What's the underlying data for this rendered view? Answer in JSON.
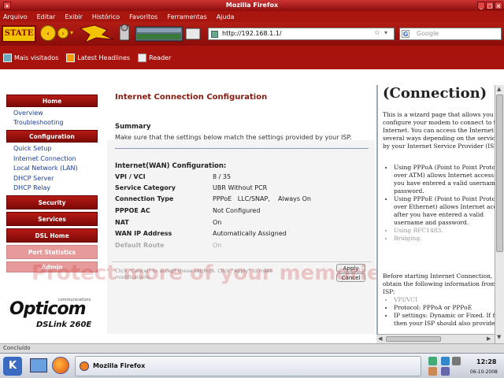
{
  "window": {
    "title": "Mozilla Firefox"
  },
  "menu": [
    "Arquivo",
    "Editar",
    "Exibir",
    "Histórico",
    "Favoritos",
    "Ferramentas",
    "Ajuda"
  ],
  "navbar": {
    "logo_text": "STATE",
    "url": "http://192.168.1.1/",
    "search_placeholder": "Google"
  },
  "bookmarks": [
    "Mais visitados",
    "Latest Headlines",
    "Reader"
  ],
  "sidebar": {
    "home": "Home",
    "home_links": [
      "Overview",
      "Troubleshooting"
    ],
    "configuration": "Configuration",
    "config_links": [
      "Quick Setup",
      "Internet Connection",
      "Local Network (LAN)",
      "DHCP Server",
      "DHCP Relay"
    ],
    "security": "Security",
    "services": "Services",
    "dsl_home": "DSL Home",
    "port_statistics": "Port Statistics",
    "admin": "Admin",
    "logo_small": "communications",
    "logo": "Opticom",
    "model": "DSLink 260E"
  },
  "main": {
    "title": "Internet Connection Configuration",
    "summary_label": "Summary",
    "summary_text": "Make sure that the settings below match the settings provided by your ISP.",
    "section": "Internet(WAN) Configuration:",
    "rows": [
      {
        "label": "VPI / VCI",
        "value": "8 / 35"
      },
      {
        "label": "Service Category",
        "value": "UBR Without PCR"
      },
      {
        "label": "Connection Type",
        "value": "PPPoE   LLC/SNAP,    Always On"
      },
      {
        "label": "PPPOE AC",
        "value": "Not Configured"
      },
      {
        "label": "NAT",
        "value": "On"
      },
      {
        "label": "WAN IP Address",
        "value": "Automatically Assigned"
      },
      {
        "label": "Default Route",
        "value": "On"
      }
    ],
    "footer_note": "Click \"Cancel\" to accept these settings. Click \"Apply\" to make modifications.",
    "apply": "Apply",
    "cancel": "Cancel",
    "watermark": "Protect more of your memories"
  },
  "wizard": {
    "heading": "(Connection)",
    "intro": "This is a wizard page that allows you to configure your modem to connect to the Internet. You can access the Internet in several ways depending on the service offered by your Internet Service Provider (ISP).",
    "bullets": [
      "Using PPPoA (Point to Point Protocol over ATM) allows Internet access after you have entered a valid username and password.",
      "Using PPPoE (Point to Point Protocol over Ethernet) allows Internet access after you have entered a valid username and password.",
      "Using RFC1483.",
      "Bridging."
    ],
    "before": "Before starting Internet Connection, please obtain the following information from your ISP:",
    "info": [
      "VPI/VCI",
      "Protocol: PPPoA or PPPoE",
      "IP settings: Dynamic or Fixed. If fixed, then your ISP should also provide"
    ]
  },
  "status": {
    "text": "Concluído"
  },
  "taskbar": {
    "task": "Mozilla Firefox",
    "time": "12:28",
    "date": "06-10-2008"
  }
}
